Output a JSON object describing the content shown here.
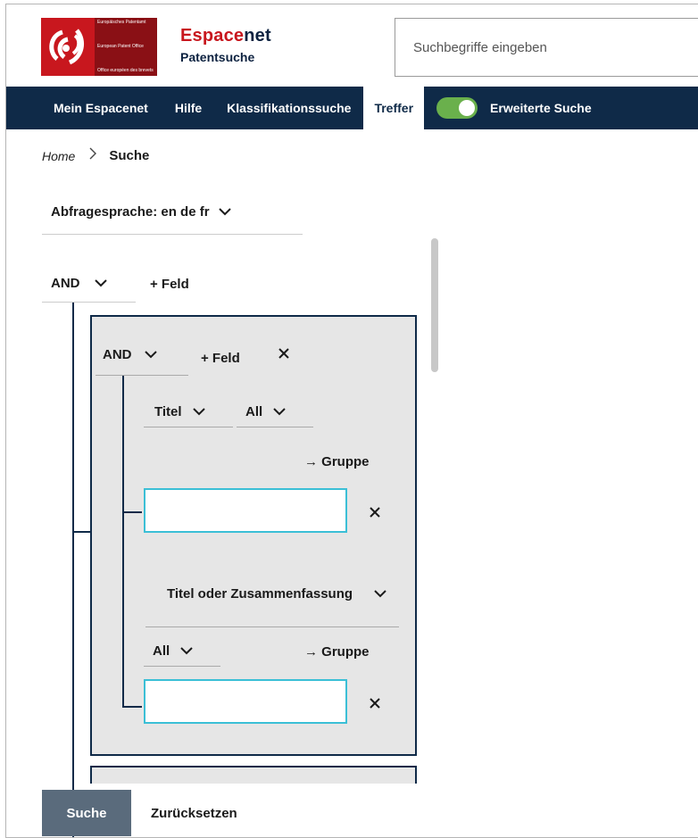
{
  "header": {
    "logo_lines": [
      "Europäisches Patentamt",
      "European Patent Office",
      "Office européen des brevets"
    ],
    "brand_part1": "Espace",
    "brand_part2": "net",
    "brand_sub": "Patentsuche",
    "search_placeholder": "Suchbegriffe eingeben"
  },
  "nav": {
    "items": [
      "Mein Espacenet",
      "Hilfe",
      "Klassifikationssuche",
      "Treffer"
    ],
    "active": "Treffer",
    "advanced_label": "Erweiterte Suche",
    "advanced_enabled": true
  },
  "breadcrumb": {
    "home": "Home",
    "current": "Suche"
  },
  "query": {
    "language_label": "Abfragesprache: en de fr",
    "root_operator": "AND",
    "add_field": "+ Feld",
    "group": {
      "operator": "AND",
      "add_field": "+ Feld",
      "field1": {
        "field": "Titel",
        "qualifier": "All",
        "to_group": "→ Gruppe",
        "value": ""
      },
      "field2": {
        "field": "Titel oder Zusammenfassung",
        "qualifier": "All",
        "to_group": "→ Gruppe",
        "value": ""
      }
    }
  },
  "footer": {
    "search_button": "Suche",
    "reset_button": "Zurücksetzen"
  },
  "colors": {
    "navy": "#0f2a48",
    "brand_red": "#c8171e",
    "toggle_green": "#6ab04c",
    "input_border": "#3bbfd6",
    "search_btn": "#5a6b7c"
  }
}
